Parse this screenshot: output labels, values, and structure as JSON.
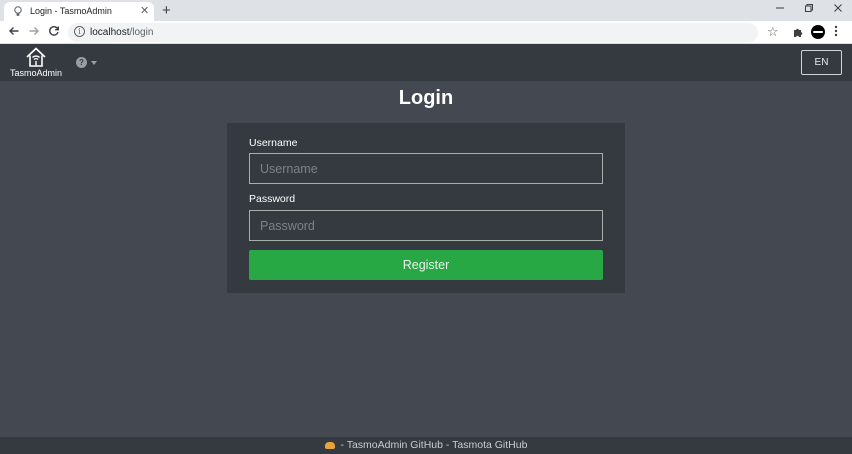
{
  "browser": {
    "tab_title": "Login - TasmoAdmin",
    "tab_close": "✕",
    "new_tab": "+",
    "url_host": "localhost",
    "url_path": "/login",
    "icons": [
      "bulb-icon",
      "back-icon",
      "forward-icon",
      "reload-icon",
      "info-icon",
      "star-icon",
      "extensions-icon",
      "profile-icon",
      "kebab-menu-icon",
      "minimize-icon",
      "restore-icon",
      "close-icon"
    ]
  },
  "navbar": {
    "brand": "TasmoAdmin",
    "help_glyph": "?",
    "language": "EN"
  },
  "page": {
    "title": "Login"
  },
  "form": {
    "username_label": "Username",
    "username_placeholder": "Username",
    "username_value": "",
    "password_label": "Password",
    "password_placeholder": "Password",
    "password_value": "",
    "submit_label": "Register"
  },
  "footer": {
    "separator": " - ",
    "link_admin": "TasmoAdmin GitHub",
    "link_tasmota": "Tasmota GitHub"
  },
  "colors": {
    "background": "#444951",
    "navbar": "#343a40",
    "success": "#28a745",
    "cloud": "#e8a33d"
  }
}
